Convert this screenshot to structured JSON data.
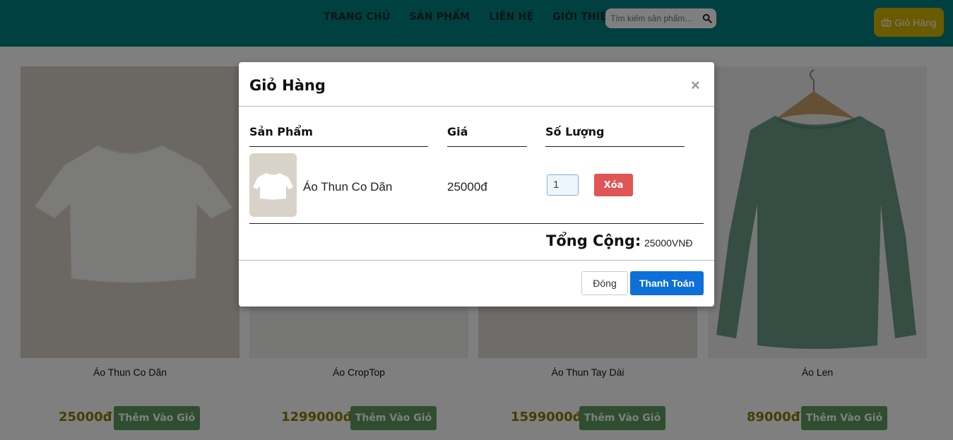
{
  "header": {
    "nav": [
      "TRANG CHỦ",
      "SẢN PHẨM",
      "LIÊN HỆ",
      "GIỚI THIỆU"
    ],
    "search_placeholder": "Tìm kiếm sản phẩm...",
    "cart_label": "Giỏ Hàng"
  },
  "products": [
    {
      "name": "Áo Thun Co Dãn",
      "price": "25000đ",
      "add_label": "Thêm Vào Giỏ"
    },
    {
      "name": "Áo CropTop",
      "price": "1299000đ",
      "add_label": "Thêm Vào Giỏ"
    },
    {
      "name": "Áo Thun Tay Dài",
      "price": "1599000đ",
      "add_label": "Thêm Vào Giỏ"
    },
    {
      "name": "Áo Len",
      "price": "89000đ",
      "add_label": "Thêm Vào Giỏ"
    }
  ],
  "modal": {
    "title": "Giỏ Hàng",
    "close_symbol": "×",
    "columns": {
      "product": "Sản Phẩm",
      "price": "Giá",
      "quantity": "Số Lượng"
    },
    "items": [
      {
        "name": "Áo Thun Co Dãn",
        "price": "25000đ",
        "quantity": "1",
        "delete_label": "Xóa"
      }
    ],
    "total_label": "Tổng Cộng:",
    "total_value": "25000VNĐ",
    "close_label": "Đóng",
    "checkout_label": "Thanh Toán"
  },
  "colors": {
    "header": "#008080",
    "cart_button": "#d4b400",
    "add_button": "#5e9a5e",
    "price": "#8a7a00",
    "delete_button": "#e05555",
    "checkout_button": "#0d6fd8"
  }
}
